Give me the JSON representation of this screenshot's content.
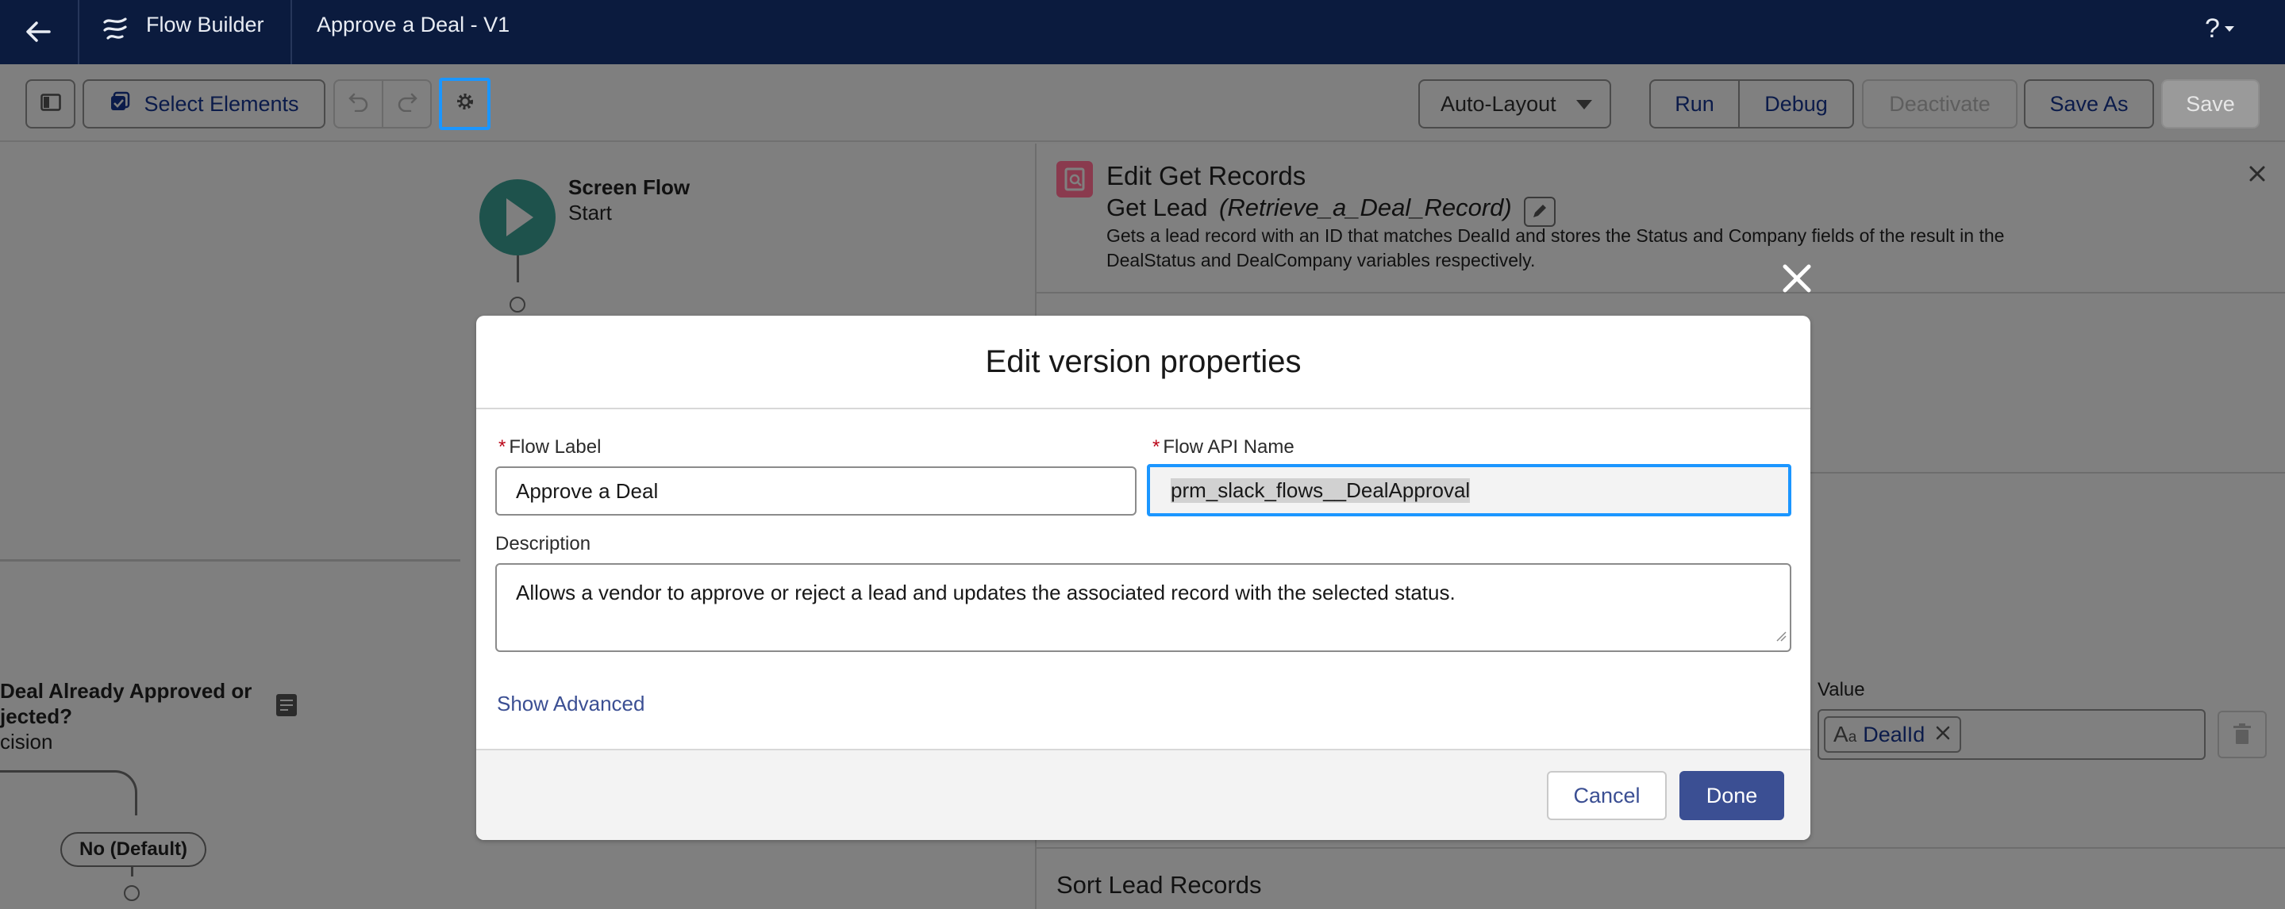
{
  "header": {
    "app_name": "Flow Builder",
    "flow_title": "Approve a Deal - V1",
    "help_label": "?"
  },
  "toolbar": {
    "select_elements": "Select Elements",
    "layout_mode": "Auto-Layout",
    "run": "Run",
    "debug": "Debug",
    "deactivate": "Deactivate",
    "save_as": "Save As",
    "save": "Save"
  },
  "canvas": {
    "start_type": "Screen Flow",
    "start_label": "Start",
    "decision_line1": "Deal Already Approved or",
    "decision_line2": "jected?",
    "decision_type": "cision",
    "default_path": "No (Default)"
  },
  "panel": {
    "heading": "Edit Get Records",
    "element_label": "Get Lead",
    "element_api": "(Retrieve_a_Deal_Record)",
    "description_line1": "Gets a lead record with an ID that matches DealId and stores the Status and Company fields of the result in the",
    "description_line2": "DealStatus and DealCompany variables respectively.",
    "value_label": "Value",
    "value_token": "DealId",
    "sort_heading": "Sort Lead Records"
  },
  "modal": {
    "title": "Edit version properties",
    "flow_label_label": "Flow Label",
    "flow_label_value": "Approve a Deal",
    "api_name_label": "Flow API Name",
    "api_name_value": "prm_slack_flows__DealApproval",
    "description_label": "Description",
    "description_value": "Allows a vendor to approve or reject a lead and updates the associated record with the selected status.",
    "show_advanced": "Show Advanced",
    "cancel": "Cancel",
    "done": "Done"
  },
  "colors": {
    "header_bg": "#0b1b3e",
    "brand_blue": "#3b4f93",
    "focus_ring": "#1b96ff",
    "overlay": "#7f7f7f"
  }
}
